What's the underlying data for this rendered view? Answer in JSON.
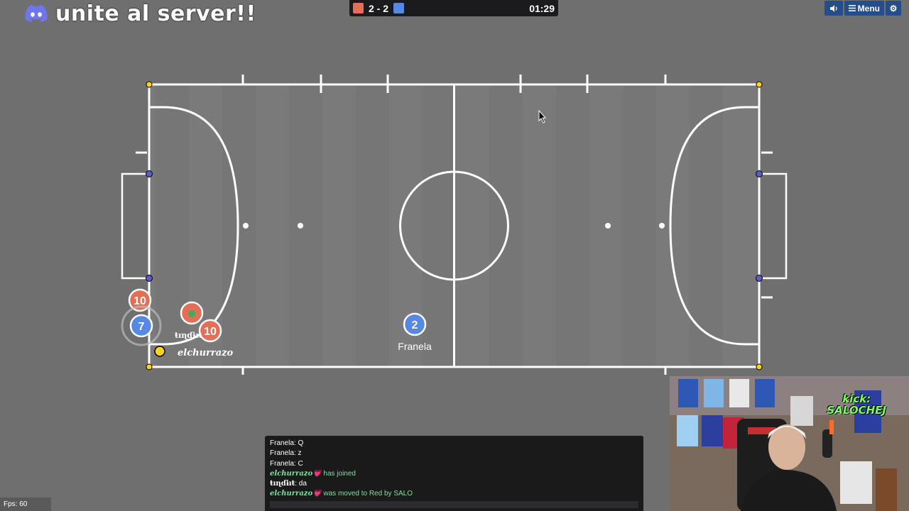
{
  "overlay": {
    "discord_text": "unite al server!!"
  },
  "scoreboard": {
    "score": "2 - 2",
    "timer": "01:29",
    "red_color": "#e56e56",
    "blue_color": "#5689e5"
  },
  "controls": {
    "sound_icon": "speaker-icon",
    "menu_label": "Menu",
    "settings_icon": "gear-icon"
  },
  "players": [
    {
      "team": "red",
      "number": "10"
    },
    {
      "team": "blue",
      "number": "7"
    },
    {
      "team": "red",
      "number": "",
      "avatar": "smiley"
    },
    {
      "team": "red",
      "number": "10",
      "name": "ŧıɳɗɨıŧ"
    },
    {
      "team": "blue",
      "number": "2",
      "name": "Franela"
    }
  ],
  "player_tags": {
    "near_goal": "elchurrazo"
  },
  "chat": {
    "lines": [
      {
        "author": "Franela",
        "text": ": Q"
      },
      {
        "author": "Franela",
        "text": ": z"
      },
      {
        "author": "Franela",
        "text": ": C"
      },
      {
        "author": "elchurrazo💗",
        "text": " has joined"
      },
      {
        "author": "ŧıɳɗɨıŧ",
        "text": ": da"
      },
      {
        "author": "elchurrazo💗",
        "text": " was moved to Red by SALO"
      }
    ]
  },
  "fps": "Fps: 60",
  "webcam": {
    "label_line1": "kick:",
    "label_line2": "SALOCHEJ"
  }
}
